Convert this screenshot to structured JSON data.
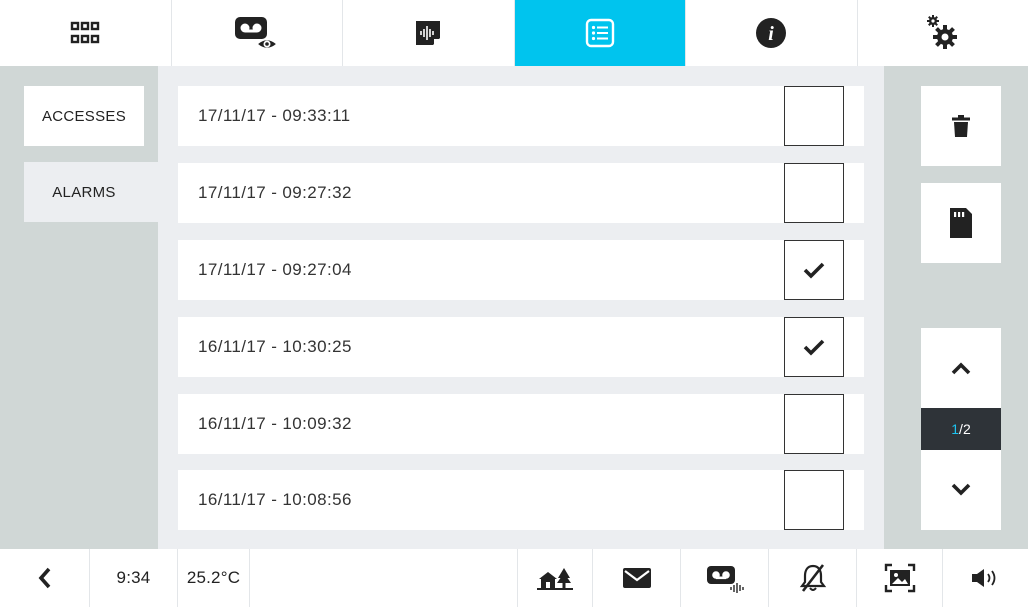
{
  "topbar": {
    "items": [
      {
        "name": "apps-grid",
        "icon": "grid-icon",
        "active": false
      },
      {
        "name": "video-eye",
        "icon": "voicemail-eye-icon",
        "active": false
      },
      {
        "name": "audio-note",
        "icon": "audio-note-icon",
        "active": false
      },
      {
        "name": "log-list",
        "icon": "list-icon",
        "active": true
      },
      {
        "name": "info",
        "icon": "info-icon",
        "active": false
      },
      {
        "name": "settings",
        "icon": "gears-icon",
        "active": false
      }
    ],
    "accent_color": "#00c4ee"
  },
  "sidebar": {
    "tabs": [
      {
        "label": "ACCESSES"
      },
      {
        "label": "ALARMS"
      }
    ]
  },
  "list": {
    "rows": [
      {
        "date": "17/11/17 - 09:33:11",
        "checked": false
      },
      {
        "date": "17/11/17 - 09:27:32",
        "checked": false
      },
      {
        "date": "17/11/17 - 09:27:04",
        "checked": true
      },
      {
        "date": "16/11/17 - 10:30:25",
        "checked": true
      },
      {
        "date": "16/11/17 - 10:09:32",
        "checked": false
      },
      {
        "date": "16/11/17 - 10:08:56",
        "checked": false
      }
    ]
  },
  "right_panel": {
    "delete_icon": "trash-icon",
    "sd_icon": "sd-card-icon",
    "pager": {
      "current": "1",
      "separator": "/",
      "total": "2"
    }
  },
  "bottombar": {
    "time": "9:34",
    "temperature": "25.2°C",
    "icons": [
      "back-icon",
      "home-trees-icon",
      "mail-icon",
      "voicemail-audio-icon",
      "bell-off-icon",
      "picture-frame-icon",
      "speaker-icon"
    ]
  }
}
